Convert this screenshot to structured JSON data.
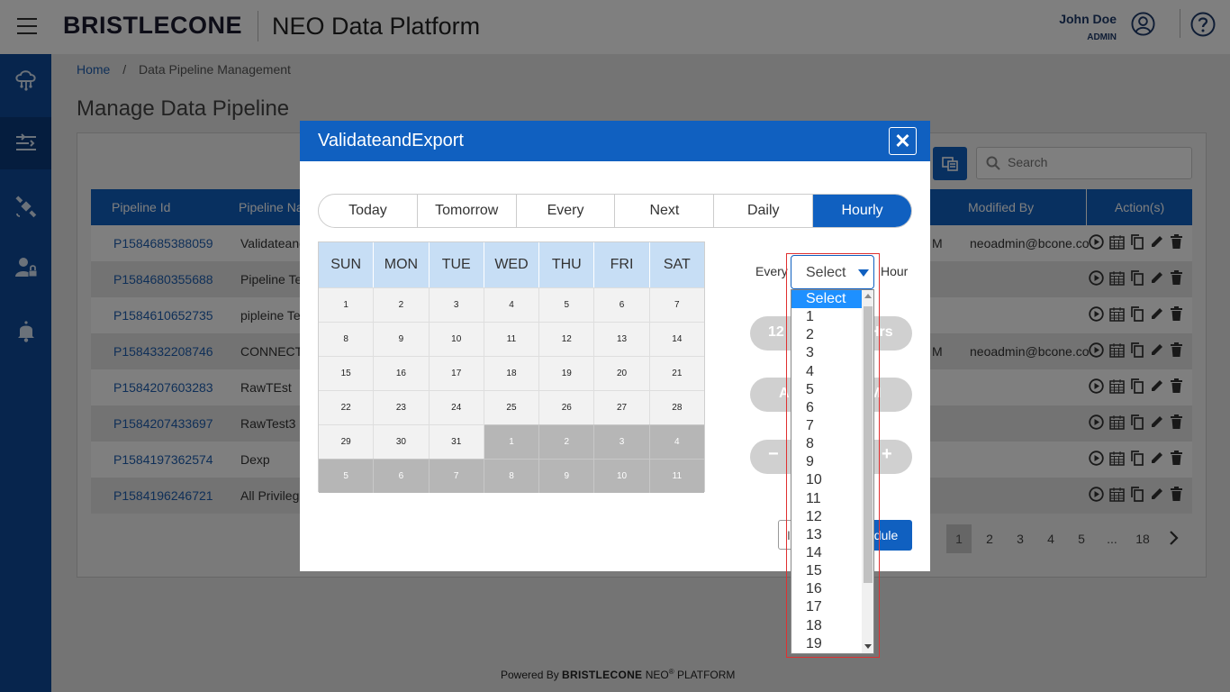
{
  "header": {
    "brand": "BRISTLECONE",
    "platform": "NEO Data Platform",
    "user_name": "John Doe",
    "user_role": "ADMIN"
  },
  "sidebar": {
    "items": [
      {
        "icon": "cloud-network-icon"
      },
      {
        "icon": "pipeline-flow-icon",
        "active": true
      },
      {
        "icon": "satellite-icon"
      },
      {
        "icon": "user-admin-icon"
      },
      {
        "icon": "bell-icon"
      }
    ]
  },
  "breadcrumb": {
    "home": "Home",
    "sep": "/",
    "current": "Data Pipeline Management"
  },
  "page_title": "Manage Data Pipeline",
  "search": {
    "placeholder": "Search"
  },
  "table": {
    "headers": {
      "id": "Pipeline Id",
      "name": "Pipeline Na",
      "modified_by": "Modified By",
      "actions": "Action(s)"
    },
    "rows": [
      {
        "id": "P1584685388059",
        "name": "Validateand",
        "modified": "neoadmin@bcone.co",
        "time": "M"
      },
      {
        "id": "P1584680355688",
        "name": "Pipeline Te",
        "modified": "",
        "time": ""
      },
      {
        "id": "P1584610652735",
        "name": "pipleine Te",
        "modified": "",
        "time": ""
      },
      {
        "id": "P1584332208746",
        "name": "CONNECTI",
        "modified": "neoadmin@bcone.co",
        "time": "M"
      },
      {
        "id": "P1584207603283",
        "name": "RawTEst",
        "modified": "",
        "time": ""
      },
      {
        "id": "P1584207433697",
        "name": "RawTest3",
        "modified": "",
        "time": ""
      },
      {
        "id": "P1584197362574",
        "name": "Dexp",
        "modified": "",
        "time": ""
      },
      {
        "id": "P1584196246721",
        "name": "All Privilege",
        "modified": "",
        "time": ""
      }
    ]
  },
  "pager": {
    "pages": [
      "1",
      "2",
      "3",
      "4",
      "5",
      "...",
      "18"
    ],
    "current": "1"
  },
  "footer": {
    "powered": "Powered By",
    "brand": "BRISTLECONE",
    "neo": "NEO",
    "reg": "®",
    "platform": "PLATFORM"
  },
  "modal": {
    "title": "ValidateandExport",
    "close": "✕",
    "tabs": [
      "Today",
      "Tomorrow",
      "Every",
      "Next",
      "Daily",
      "Hourly"
    ],
    "active_tab": "Hourly",
    "calendar": {
      "days": [
        "SUN",
        "MON",
        "TUE",
        "WED",
        "THU",
        "FRI",
        "SAT"
      ],
      "weeks": [
        [
          "1",
          "2",
          "3",
          "4",
          "5",
          "6",
          "7"
        ],
        [
          "8",
          "9",
          "10",
          "11",
          "12",
          "13",
          "14"
        ],
        [
          "15",
          "16",
          "17",
          "18",
          "19",
          "20",
          "21"
        ],
        [
          "22",
          "23",
          "24",
          "25",
          "26",
          "27",
          "28"
        ],
        [
          "29",
          "30",
          "31",
          "1",
          "2",
          "3",
          "4"
        ],
        [
          "5",
          "6",
          "7",
          "8",
          "9",
          "10",
          "11"
        ]
      ],
      "dim_start_index": 31
    },
    "every_label": "Every",
    "hour_label": "Hour",
    "pill_1_left": "12",
    "pill_1_right": "Hrs",
    "pill_2_left": "A",
    "pill_2_right": "M",
    "minus": "−",
    "plus": "+",
    "schedule_btn": "edule",
    "cancel_btn": "I"
  },
  "select": {
    "value": "Select",
    "options": [
      "Select",
      "1",
      "2",
      "3",
      "4",
      "5",
      "6",
      "7",
      "8",
      "9",
      "10",
      "11",
      "12",
      "13",
      "14",
      "15",
      "16",
      "17",
      "18",
      "19"
    ],
    "highlighted": "Select"
  },
  "colors": {
    "primary": "#1060c0",
    "sidebar": "#0f4a9a",
    "highlight": "#1e90ff",
    "frame": "#e03030"
  }
}
